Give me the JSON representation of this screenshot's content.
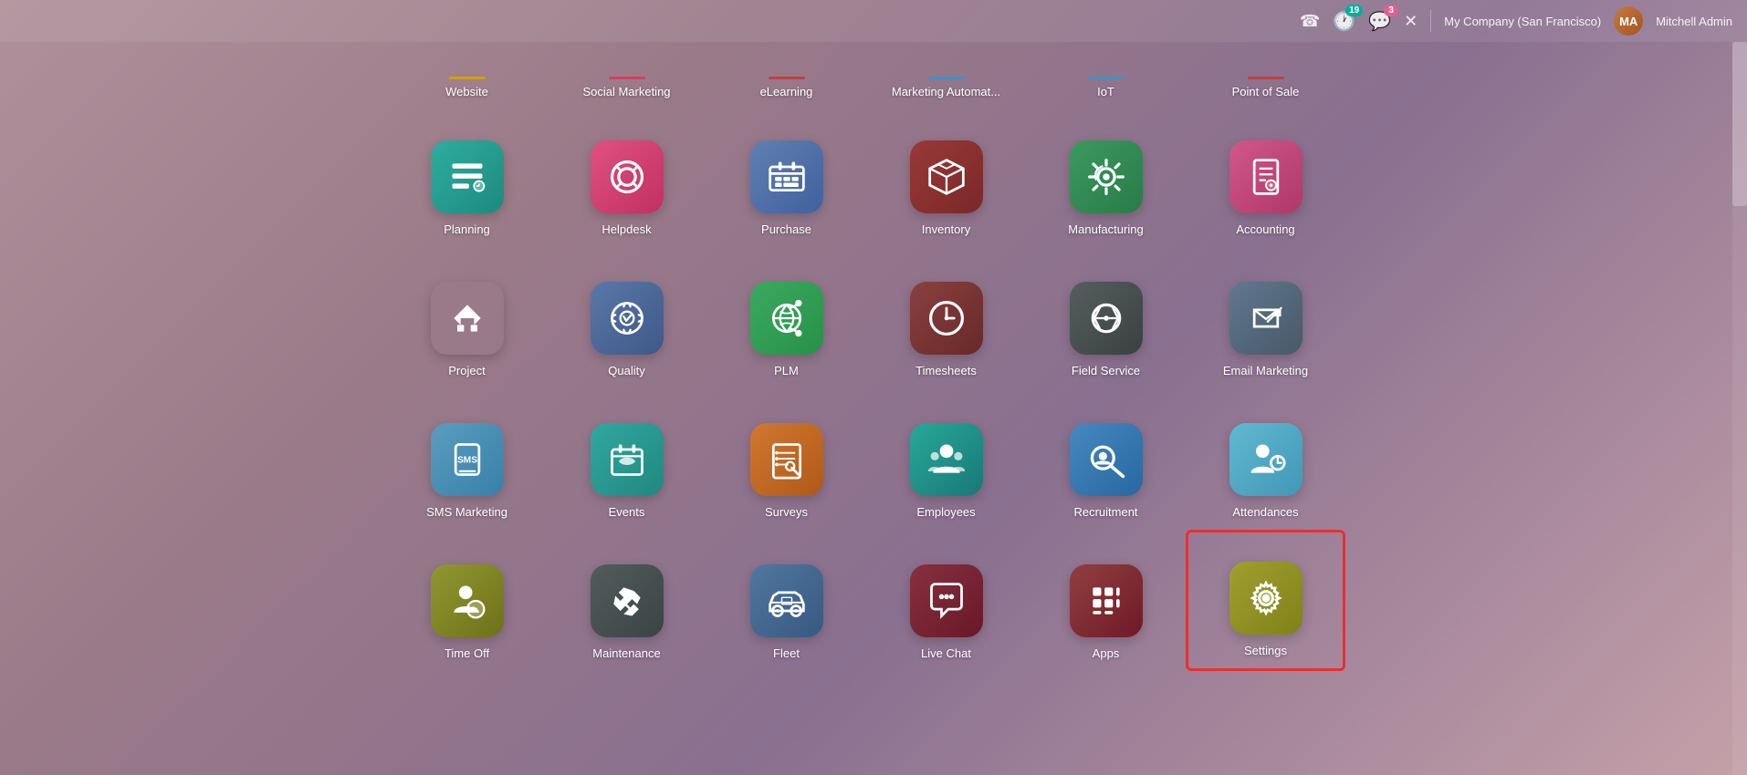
{
  "topbar": {
    "phone_icon": "☎",
    "activity_count": "19",
    "chat_count": "3",
    "close_icon": "✕",
    "company": "My Company (San Francisco)",
    "user": "Mitchell Admin",
    "avatar_initials": "MA"
  },
  "partial_row": [
    {
      "id": "website",
      "label": "Website",
      "accent_color": "#d4a000"
    },
    {
      "id": "social-marketing",
      "label": "Social Marketing",
      "accent_color": "#d44060"
    },
    {
      "id": "elearning",
      "label": "eLearning",
      "accent_color": "#c04040"
    },
    {
      "id": "marketing-automat",
      "label": "Marketing Automat...",
      "accent_color": "#4090c0"
    },
    {
      "id": "iot",
      "label": "IoT",
      "accent_color": "#4090c0"
    },
    {
      "id": "point-of-sale",
      "label": "Point of Sale",
      "accent_color": "#c04040"
    }
  ],
  "rows": [
    [
      {
        "id": "planning",
        "label": "Planning",
        "bg": "bg-teal",
        "icon": "planning"
      },
      {
        "id": "helpdesk",
        "label": "Helpdesk",
        "bg": "bg-pink",
        "icon": "helpdesk"
      },
      {
        "id": "purchase",
        "label": "Purchase",
        "bg": "bg-blue-slate",
        "icon": "purchase"
      },
      {
        "id": "inventory",
        "label": "Inventory",
        "bg": "bg-dark-red",
        "icon": "inventory"
      },
      {
        "id": "manufacturing",
        "label": "Manufacturing",
        "bg": "bg-green",
        "icon": "manufacturing"
      },
      {
        "id": "accounting",
        "label": "Accounting",
        "bg": "bg-pink-light",
        "icon": "accounting"
      }
    ],
    [
      {
        "id": "project",
        "label": "Project",
        "bg": "bg-indigo",
        "icon": "project"
      },
      {
        "id": "quality",
        "label": "Quality",
        "bg": "bg-slate",
        "icon": "quality"
      },
      {
        "id": "plm",
        "label": "PLM",
        "bg": "bg-green2",
        "icon": "plm"
      },
      {
        "id": "timesheets",
        "label": "Timesheets",
        "bg": "bg-dark-brown",
        "icon": "timesheets"
      },
      {
        "id": "field-service",
        "label": "Field Service",
        "bg": "bg-dark-gray",
        "icon": "field-service"
      },
      {
        "id": "email-marketing",
        "label": "Email Marketing",
        "bg": "bg-gray-blue",
        "icon": "email-marketing"
      }
    ],
    [
      {
        "id": "sms-marketing",
        "label": "SMS Marketing",
        "bg": "bg-blue-light",
        "icon": "sms-marketing"
      },
      {
        "id": "events",
        "label": "Events",
        "bg": "bg-teal2",
        "icon": "events"
      },
      {
        "id": "surveys",
        "label": "Surveys",
        "bg": "bg-orange",
        "icon": "surveys"
      },
      {
        "id": "employees",
        "label": "Employees",
        "bg": "bg-teal3",
        "icon": "employees"
      },
      {
        "id": "recruitment",
        "label": "Recruitment",
        "bg": "bg-blue2",
        "icon": "recruitment"
      },
      {
        "id": "attendances",
        "label": "Attendances",
        "bg": "bg-cyan",
        "icon": "attendances"
      }
    ],
    [
      {
        "id": "time-off",
        "label": "Time Off",
        "bg": "bg-olive",
        "icon": "time-off"
      },
      {
        "id": "maintenance",
        "label": "Maintenance",
        "bg": "bg-dark-steel",
        "icon": "maintenance"
      },
      {
        "id": "fleet",
        "label": "Fleet",
        "bg": "bg-steel-blue",
        "icon": "fleet"
      },
      {
        "id": "live-chat",
        "label": "Live Chat",
        "bg": "bg-dark-red2",
        "icon": "live-chat"
      },
      {
        "id": "apps",
        "label": "Apps",
        "bg": "bg-dark-red3",
        "icon": "apps"
      },
      {
        "id": "settings",
        "label": "Settings",
        "bg": "bg-olive2",
        "icon": "settings",
        "highlighted": true
      }
    ]
  ]
}
